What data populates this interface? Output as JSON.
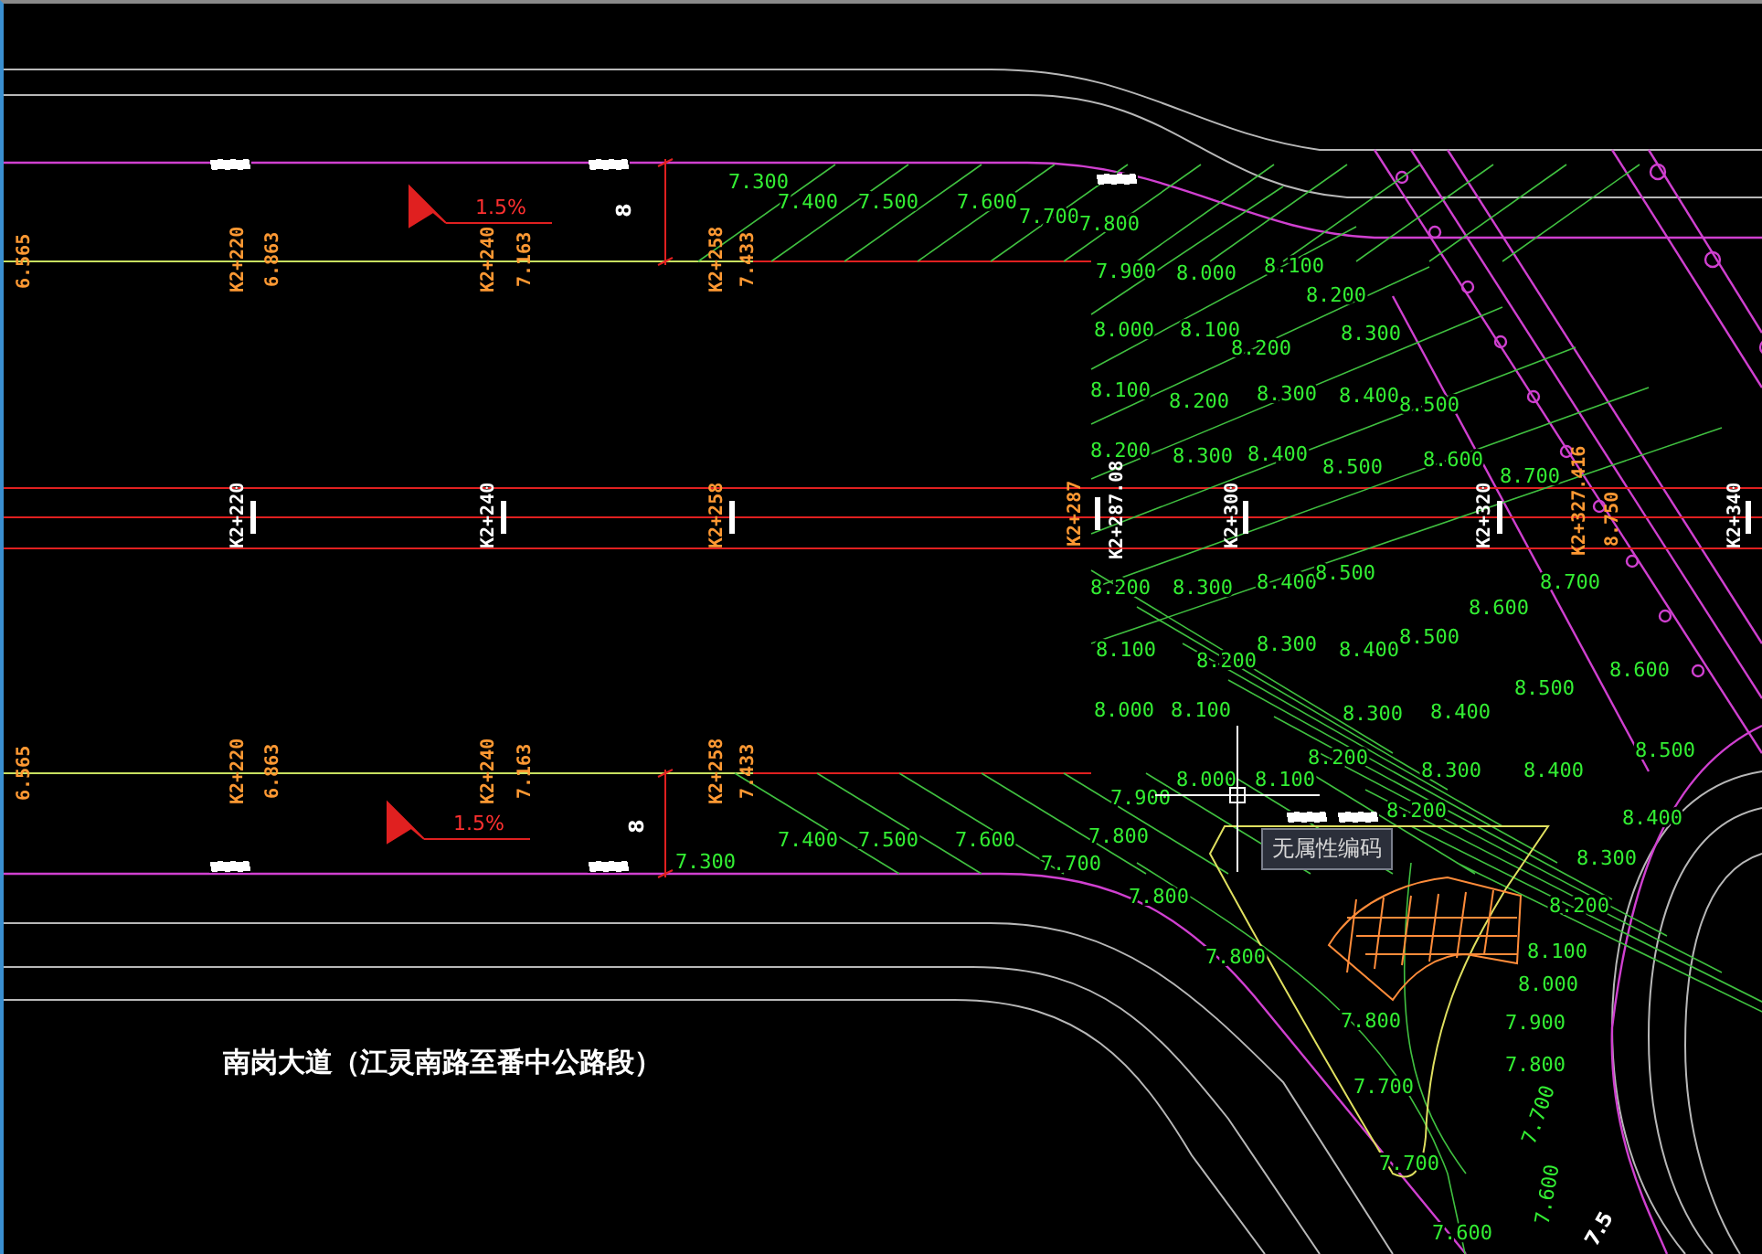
{
  "drawing": {
    "road_name": "南岗大道（江灵南路至番中公路段）",
    "tooltip": "无属性编码",
    "station_labels": [
      {
        "text": "6.565",
        "color": "#ff9933"
      },
      {
        "text": "K2+220",
        "color": "#ff9933"
      },
      {
        "text": "6.863",
        "color": "#ff9933"
      },
      {
        "text": "K2+240",
        "color": "#ff9933"
      },
      {
        "text": "7.163",
        "color": "#ff9933"
      },
      {
        "text": "K2+258",
        "color": "#ff9933"
      },
      {
        "text": "7.433",
        "color": "#ff9933"
      },
      {
        "text": "K2+220",
        "color": "#ffffff"
      },
      {
        "text": "K2+240",
        "color": "#ffffff"
      },
      {
        "text": "K2+258",
        "color": "#ff9933"
      },
      {
        "text": "K2+287",
        "color": "#ff9933"
      },
      {
        "text": "K2+287.08",
        "color": "#ffffff"
      },
      {
        "text": "K2+300",
        "color": "#ffffff"
      },
      {
        "text": "K2+320",
        "color": "#ffffff"
      },
      {
        "text": "K2+327.416",
        "color": "#ff9933"
      },
      {
        "text": "8.750",
        "color": "#ff9933"
      },
      {
        "text": "K2+340",
        "color": "#ffffff"
      },
      {
        "text": "6.565",
        "color": "#ff9933"
      },
      {
        "text": "K2+220",
        "color": "#ff9933"
      },
      {
        "text": "6.863",
        "color": "#ff9933"
      },
      {
        "text": "K2+240",
        "color": "#ff9933"
      },
      {
        "text": "7.163",
        "color": "#ff9933"
      },
      {
        "text": "K2+258",
        "color": "#ff9933"
      },
      {
        "text": "7.433",
        "color": "#ff9933"
      }
    ],
    "slope_labels": [
      "1.5%",
      "1.5%"
    ],
    "dimension_labels": [
      "8",
      "8",
      "7.5"
    ],
    "elevation_labels": [
      "7.300",
      "7.400",
      "7.500",
      "7.600",
      "7.700",
      "7.800",
      "7.900",
      "8.000",
      "8.100",
      "8.200",
      "8.000",
      "8.100",
      "8.200",
      "8.300",
      "8.100",
      "8.200",
      "8.300",
      "8.400",
      "8.500",
      "8.200",
      "8.300",
      "8.400",
      "8.500",
      "8.600",
      "8.700",
      "8.200",
      "8.300",
      "8.400",
      "8.500",
      "8.100",
      "8.200",
      "8.300",
      "8.400",
      "8.500",
      "8.600",
      "8.700",
      "8.000",
      "8.100",
      "8.300",
      "8.400",
      "8.500",
      "8.600",
      "7.900",
      "8.000",
      "8.100",
      "8.200",
      "8.300",
      "8.400",
      "8.500",
      "8.200",
      "8.400",
      "7.300",
      "7.400",
      "7.500",
      "7.600",
      "7.700",
      "7.800",
      "7.800",
      "8.300",
      "8.200",
      "7.800",
      "8.100",
      "8.000",
      "7.800",
      "7.900",
      "7.800",
      "7.700",
      "7.700",
      "7.700",
      "7.600",
      "7.600"
    ]
  }
}
